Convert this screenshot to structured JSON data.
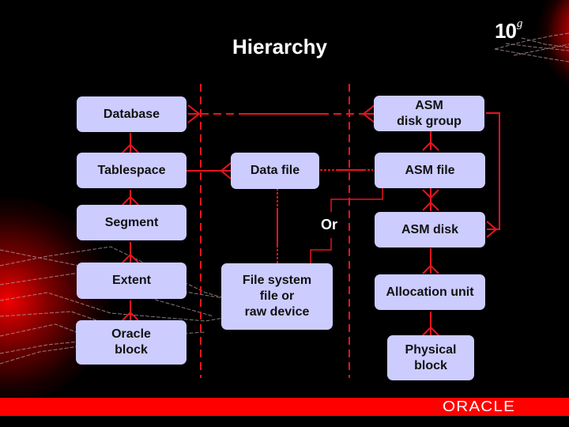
{
  "slide": {
    "title": "Hierarchy",
    "product_badge": {
      "main": "10",
      "superscript": "g"
    },
    "footer_logo": "ORACLE",
    "colors": {
      "background": "#000000",
      "box_fill": "#ccccff",
      "connector": "#e8141e",
      "footer_bar": "#ff0000"
    }
  },
  "diagram": {
    "logical_column": [
      {
        "id": "database",
        "label": "Database"
      },
      {
        "id": "tablespace",
        "label": "Tablespace"
      },
      {
        "id": "segment",
        "label": "Segment"
      },
      {
        "id": "extent",
        "label": "Extent"
      },
      {
        "id": "oracle-block",
        "label": "Oracle\nblock"
      }
    ],
    "physical_column": [
      {
        "id": "data-file",
        "label": "Data file"
      },
      {
        "id": "file-system",
        "label": "File system\nfile or\nraw device"
      }
    ],
    "asm_column": [
      {
        "id": "asm-disk-group",
        "label": "ASM\ndisk group"
      },
      {
        "id": "asm-file",
        "label": "ASM file"
      },
      {
        "id": "asm-disk",
        "label": "ASM disk"
      },
      {
        "id": "allocation-unit",
        "label": "Allocation unit"
      },
      {
        "id": "physical-block",
        "label": "Physical\nblock"
      }
    ],
    "or_label": "Or",
    "relationships": [
      {
        "from": "database",
        "to": "tablespace",
        "type": "one-to-many"
      },
      {
        "from": "tablespace",
        "to": "segment",
        "type": "one-to-many"
      },
      {
        "from": "segment",
        "to": "extent",
        "type": "one-to-many"
      },
      {
        "from": "extent",
        "to": "oracle-block",
        "type": "one-to-many"
      },
      {
        "from": "tablespace",
        "to": "data-file",
        "type": "one-to-many"
      },
      {
        "from": "data-file",
        "to": "file-system",
        "type": "one-to-one"
      },
      {
        "from": "data-file",
        "to": "asm-file",
        "type": "one-to-one"
      },
      {
        "from": "database",
        "to": "asm-disk-group",
        "type": "many-to-many"
      },
      {
        "from": "asm-disk-group",
        "to": "asm-file",
        "type": "one-to-many"
      },
      {
        "from": "asm-file",
        "to": "asm-disk",
        "type": "many-to-many"
      },
      {
        "from": "asm-disk-group",
        "to": "asm-disk",
        "type": "one-to-many"
      },
      {
        "from": "asm-disk",
        "to": "allocation-unit",
        "type": "one-to-many"
      },
      {
        "from": "allocation-unit",
        "to": "physical-block",
        "type": "one-to-many"
      }
    ]
  }
}
